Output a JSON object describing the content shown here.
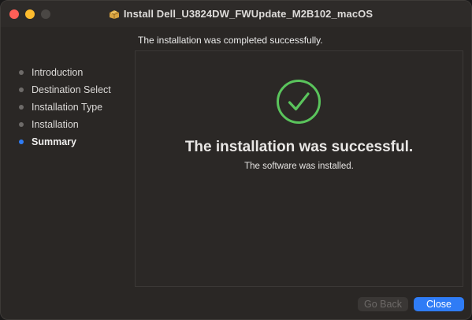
{
  "window": {
    "title": "Install Dell_U3824DW_FWUpdate_M2B102_macOS",
    "title_icon": "package-icon"
  },
  "header": {
    "message": "The installation was completed successfully."
  },
  "steps": [
    {
      "label": "Introduction",
      "active": false
    },
    {
      "label": "Destination Select",
      "active": false
    },
    {
      "label": "Installation Type",
      "active": false
    },
    {
      "label": "Installation",
      "active": false
    },
    {
      "label": "Summary",
      "active": true
    }
  ],
  "result": {
    "icon": "checkmark-circle-icon",
    "title": "The installation was successful.",
    "subtitle": "The software was installed."
  },
  "buttons": {
    "back_label": "Go Back",
    "back_enabled": false,
    "close_label": "Close"
  },
  "colors": {
    "accent": "#2f7cf6",
    "success": "#5ac45c",
    "traffic_close": "#ff5f57",
    "traffic_min": "#febc2e"
  }
}
